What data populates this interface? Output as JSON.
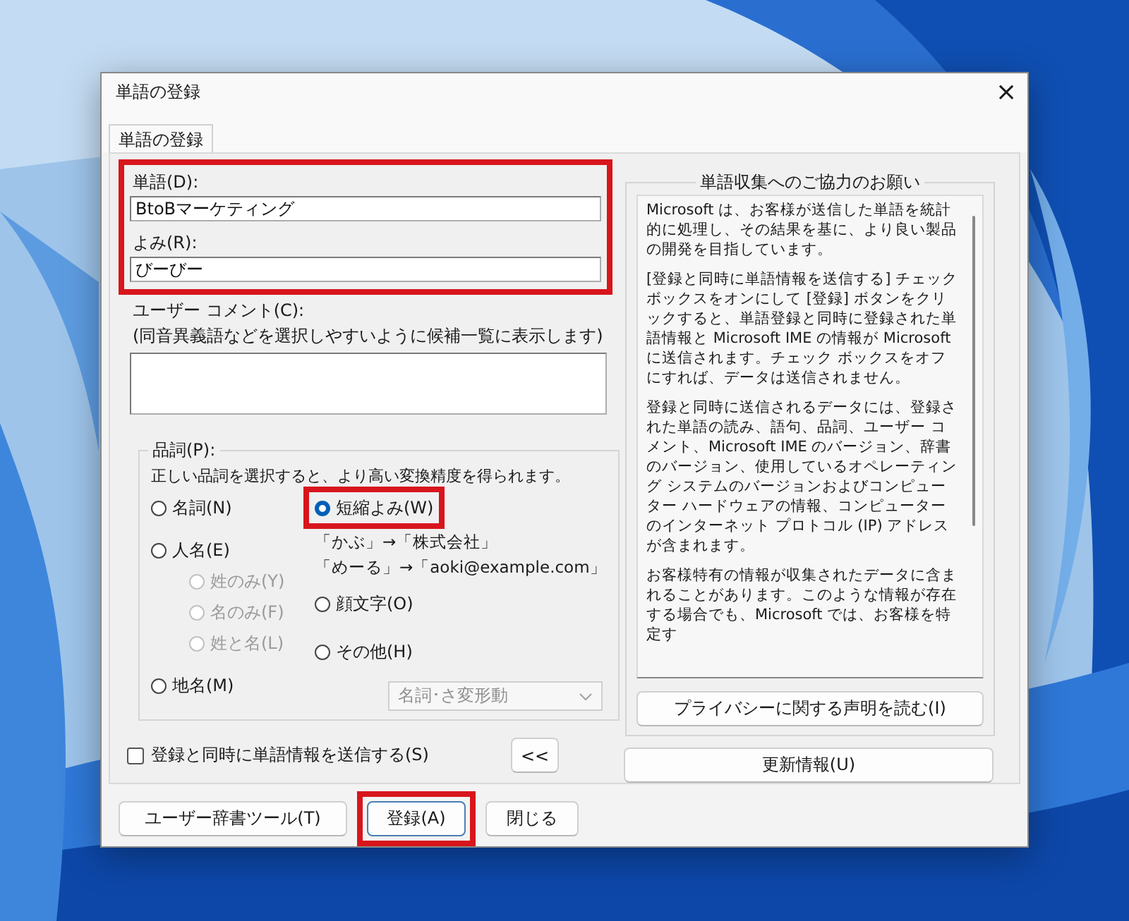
{
  "window": {
    "title": "単語の登録",
    "close": "×"
  },
  "tabs": [
    {
      "label": "単語の登録",
      "selected": true
    }
  ],
  "entry": {
    "highlighted": true,
    "fields": [
      {
        "label": "単語(D):",
        "value": "BtoBマーケティング"
      },
      {
        "label": "よみ(R):",
        "value": "びーびー"
      }
    ]
  },
  "comment": {
    "label": "ユーザー コメント(C):",
    "hint": "(同音異義語などを選択しやすいように候補一覧に表示します)"
  },
  "part_of_speech": {
    "label": "品詞(P):",
    "description": "正しい品詞を選択すると、より高い変換精度を得られます。",
    "left_options": [
      {
        "label": "名詞(N)",
        "selected": false,
        "disabled": false
      },
      {
        "label": "人名(E)",
        "selected": false,
        "disabled": false,
        "children": [
          {
            "label": "姓のみ(Y)",
            "selected": false,
            "disabled": true
          },
          {
            "label": "名のみ(F)",
            "selected": false,
            "disabled": true
          },
          {
            "label": "姓と名(L)",
            "selected": false,
            "disabled": true
          }
        ]
      },
      {
        "label": "地名(M)",
        "selected": false,
        "disabled": false
      }
    ],
    "right_options": [
      {
        "label": "短縮よみ(W)",
        "selected": true,
        "disabled": false,
        "highlighted": true,
        "examples": [
          "「かぶ」→「株式会社」",
          "「めーる」→「aoki@example.com」"
        ]
      },
      {
        "label": "顔文字(O)",
        "selected": false,
        "disabled": false,
        "highlighted": false
      },
      {
        "label": "その他(H)",
        "selected": false,
        "disabled": false,
        "highlighted": false
      }
    ],
    "dropdown": {
      "value": "名詞･さ変形動",
      "disabled": true
    }
  },
  "send_checkbox": {
    "label": "登録と同時に単語情報を送信する(S)",
    "checked": false
  },
  "collapse_button": "<<",
  "info_panel": {
    "title": "単語収集へのご協力のお願い",
    "paragraphs": [
      "Microsoft は、お客様が送信した単語を統計的に処理し、その結果を基に、より良い製品の開発を目指しています。",
      "[登録と同時に単語情報を送信する] チェックボックスをオンにして [登録] ボタンをクリックすると、単語登録と同時に登録された単語情報と Microsoft IME の情報が Microsoft に送信されます。チェック ボックスをオフにすれば、データは送信されません。",
      "登録と同時に送信されるデータには、登録された単語の読み、語句、品詞、ユーザー コメント、Microsoft IME のバージョン、辞書のバージョン、使用しているオペレーティング システムのバージョンおよびコンピューター ハードウェアの情報、コンピューターのインターネット プロトコル (IP) アドレスが含まれます。",
      "お客様特有の情報が収集されたデータに含まれることがあります。このような情報が存在する場合でも、Microsoft では、お客様を特定す"
    ],
    "privacy_button": "プライバシーに関する声明を読む(I)"
  },
  "update_button": "更新情報(U)",
  "buttons": [
    {
      "label": "ユーザー辞書ツール(T)",
      "highlighted": false,
      "default": false
    },
    {
      "label": "登録(A)",
      "highlighted": true,
      "default": true
    },
    {
      "label": "閉じる",
      "highlighted": false,
      "default": false
    }
  ]
}
